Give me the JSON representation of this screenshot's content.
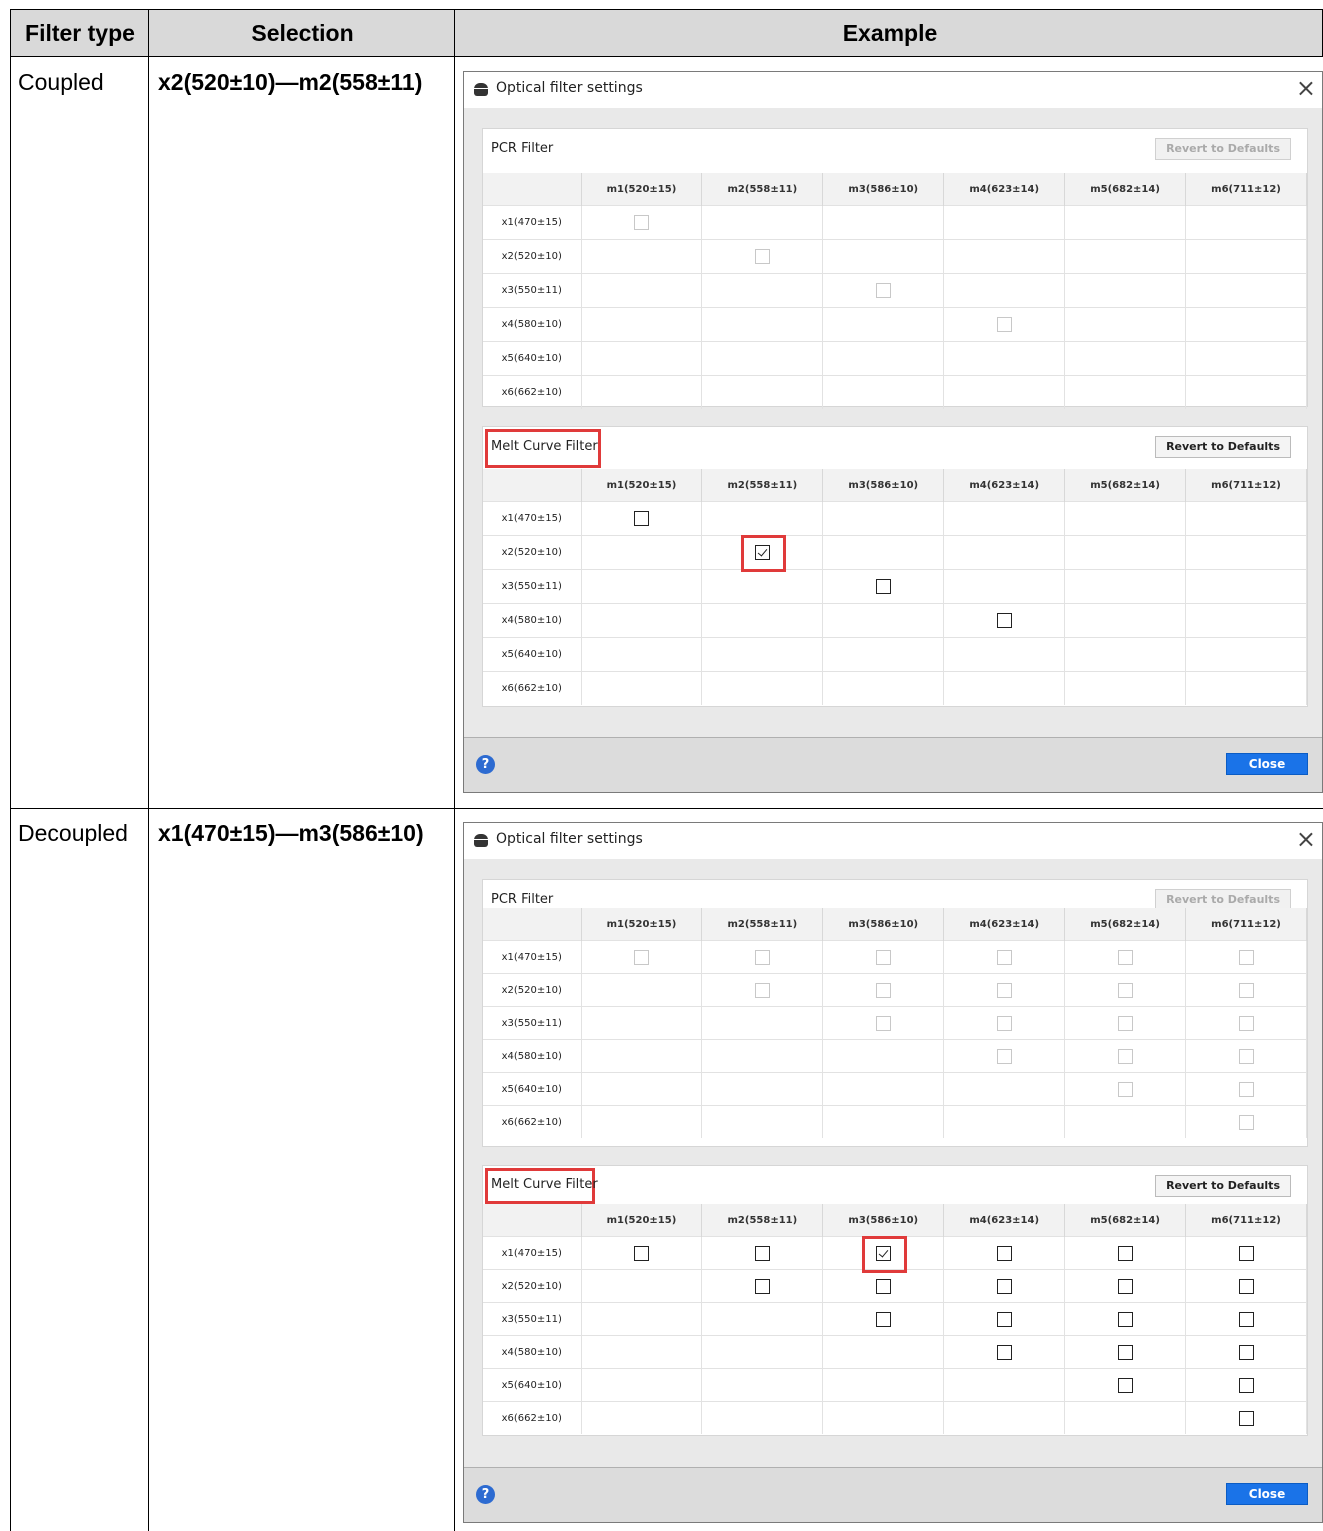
{
  "header": {
    "col1": "Filter type",
    "col2": "Selection",
    "col3": "Example"
  },
  "rows": [
    {
      "type": "Coupled",
      "selection": "x2(520±10)—m2(558±11)"
    },
    {
      "type": "Decoupled",
      "selection": "x1(470±15)—m3(586±10)"
    }
  ],
  "dialog": {
    "title": "Optical filter settings",
    "pcr_title": "PCR Filter",
    "melt_title": "Melt Curve Filter",
    "revert_label": "Revert to Defaults",
    "close_label": "Close",
    "help_glyph": "?",
    "close_glyph": "×",
    "columns": [
      "m1(520±15)",
      "m2(558±11)",
      "m3(586±10)",
      "m4(623±14)",
      "m5(682±14)",
      "m6(711±12)"
    ],
    "rows": [
      "x1(470±15)",
      "x2(520±10)",
      "x3(550±11)",
      "x4(580±10)",
      "x5(640±10)",
      "x6(662±10)"
    ]
  },
  "coupled": {
    "pcr": {
      "checkboxes_enabled": false,
      "revert_enabled": false,
      "layout": "diagonal-first-four"
    },
    "melt": {
      "checkboxes_enabled": true,
      "revert_enabled": true,
      "checked": [
        "x2(520±10)|m2(558±11)"
      ]
    }
  },
  "decoupled": {
    "pcr": {
      "checkboxes_enabled": false,
      "revert_enabled": false,
      "layout": "upper-triangle"
    },
    "melt": {
      "checkboxes_enabled": true,
      "revert_enabled": true,
      "checked": [
        "x1(470±15)|m3(586±10)"
      ]
    }
  }
}
